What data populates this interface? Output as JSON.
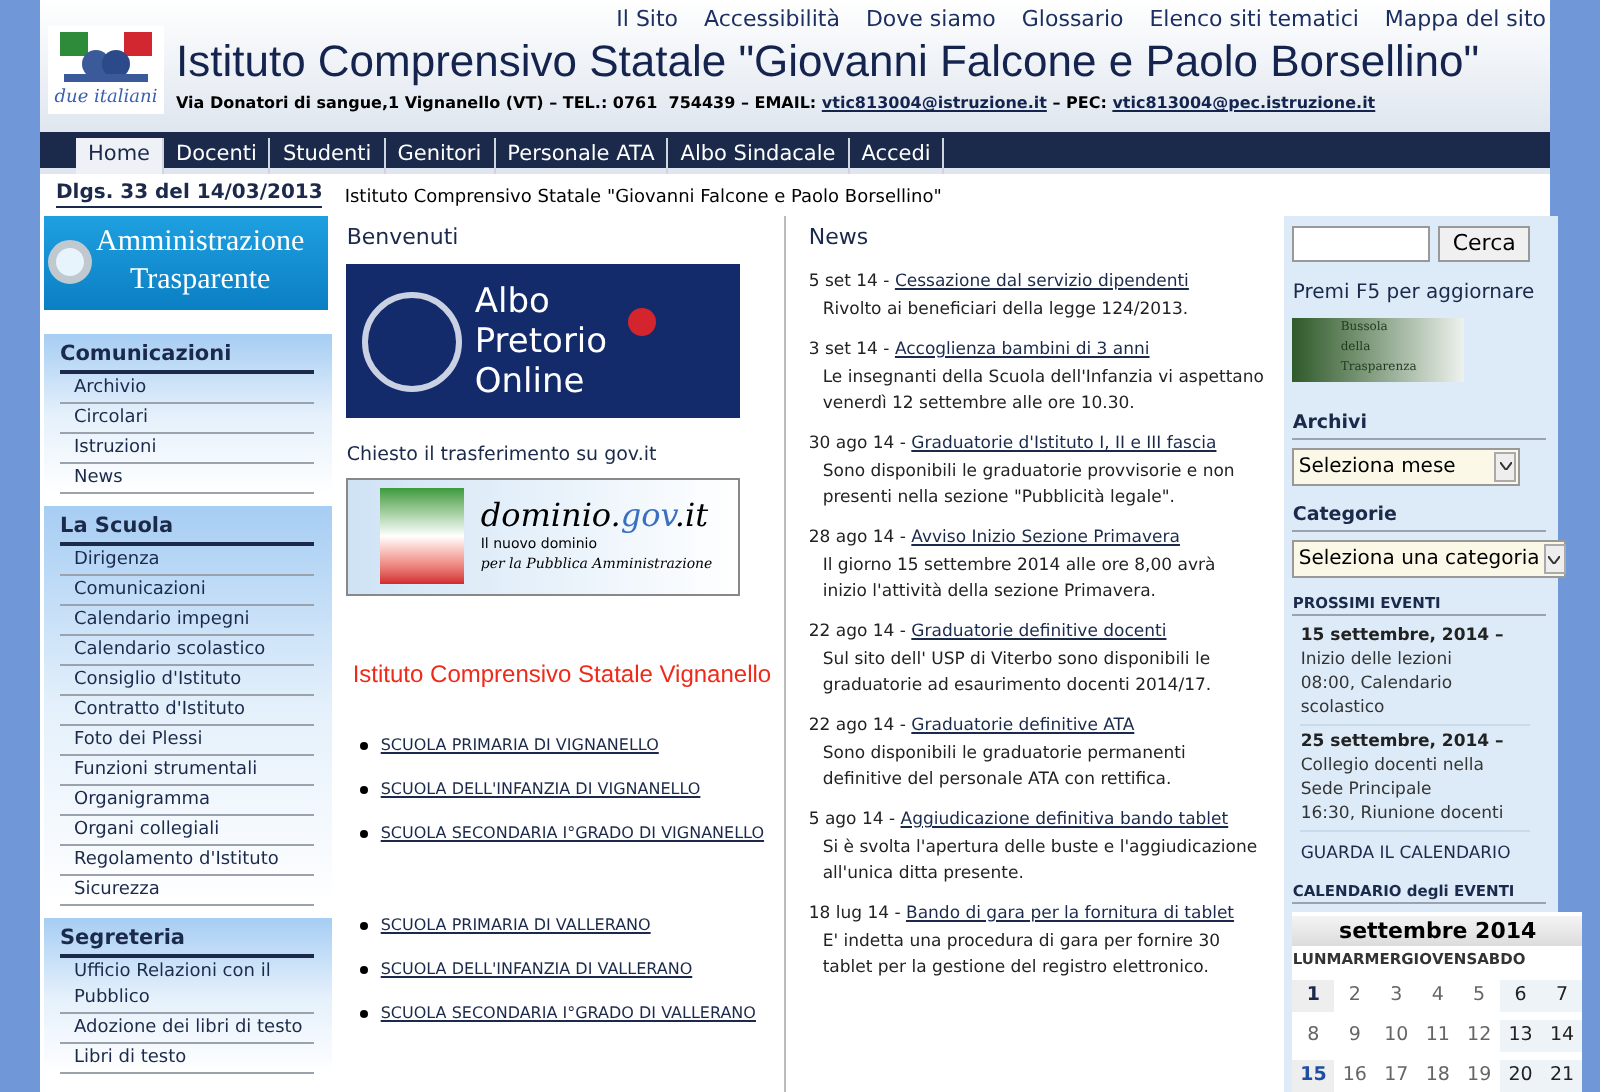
{
  "top_links": [
    "Il Sito",
    "Accessibilità",
    "Dove siamo",
    "Glossario",
    "Elenco siti tematici",
    "Mappa del sito"
  ],
  "logo": {
    "caption": "due italiani"
  },
  "header": {
    "title": "Istituto Comprensivo Statale \"Giovanni Falcone e Paolo Borsellino\"",
    "address": "Via Donatori di sangue,1 Vignanello (VT) – TEL.: 0761  754439 – EMAIL: ",
    "email": "vtic813004@istruzione.it",
    "pec_label": " – PEC: ",
    "pec": "vtic813004@pec.istruzione.it"
  },
  "nav": [
    {
      "label": "Home",
      "selected": true
    },
    {
      "label": "Docenti",
      "selected": false
    },
    {
      "label": "Studenti",
      "selected": false
    },
    {
      "label": "Genitori",
      "selected": false
    },
    {
      "label": "Personale ATA",
      "selected": false
    },
    {
      "label": "Albo Sindacale",
      "selected": false
    },
    {
      "label": "Accedi",
      "selected": false
    }
  ],
  "sidebar": {
    "decree": "Dlgs. 33 del 14/03/2013",
    "banner": [
      "Amministrazione",
      "Trasparente"
    ],
    "sections": [
      {
        "title": "Comunicazioni",
        "items": [
          "Archivio",
          "Circolari",
          "Istruzioni",
          "News"
        ]
      },
      {
        "title": "La Scuola",
        "items": [
          "Dirigenza",
          "Comunicazioni",
          "Calendario impegni",
          "Calendario scolastico",
          "Consiglio d'Istituto",
          "Contratto d'Istituto",
          "Foto dei Plessi",
          "Funzioni strumentali",
          "Organigramma",
          "Organi collegiali",
          "Regolamento d'Istituto",
          "Sicurezza"
        ]
      },
      {
        "title": "Segreteria",
        "items": [
          "Ufficio Relazioni con il Pubblico",
          "Adozione dei libri di testo",
          "Libri di testo"
        ]
      }
    ]
  },
  "breadcrumb": "Istituto Comprensivo Statale \"Giovanni Falcone e Paolo Borsellino\"",
  "welcome": {
    "title": "Benvenuti",
    "albo": [
      "Albo",
      "Pretorio",
      "Online"
    ],
    "transfer": "Chiesto il trasferimento su gov.it",
    "domain": {
      "name": "dominio.",
      "gov": "gov",
      "tld": ".it",
      "line1": "Il nuovo dominio",
      "line2": "per la Pubblica Amministrazione"
    },
    "school_title": "Istituto Comprensivo Statale Vignanello",
    "schools": [
      [
        "SCUOLA PRIMARIA DI VIGNANELLO",
        "SCUOLA DELL'INFANZIA DI VIGNANELLO",
        "SCUOLA SECONDARIA I°GRADO DI VIGNANELLO"
      ],
      [
        "SCUOLA PRIMARIA DI VALLERANO",
        "SCUOLA DELL'INFANZIA DI VALLERANO",
        "SCUOLA SECONDARIA I°GRADO DI VALLERANO"
      ]
    ]
  },
  "news": {
    "title": "News",
    "items": [
      {
        "date": "5 set 14 - ",
        "title": "Cessazione dal servizio dipendenti",
        "text": "Rivolto ai beneficiari della legge 124/2013."
      },
      {
        "date": "3 set 14 - ",
        "title": "Accoglienza bambini di 3 anni",
        "text": "Le insegnanti della Scuola dell'Infanzia vi aspettano venerdì 12 settembre alle ore 10.30."
      },
      {
        "date": "30 ago 14 - ",
        "title": "Graduatorie d'Istituto I, II e III fascia",
        "text": "Sono disponibili le graduatorie  provvisorie e non presenti nella sezione \"Pubblicità legale\"."
      },
      {
        "date": "28 ago 14 - ",
        "title": "Avviso Inizio Sezione Primavera",
        "text": "Il giorno 15 settembre 2014 alle ore 8,00 avrà inizio l'attività della sezione Primavera."
      },
      {
        "date": "22 ago 14 - ",
        "title": "Graduatorie definitive docenti",
        "text": "Sul sito dell' USP di Viterbo sono disponibili le graduatorie ad esaurimento docenti 2014/17."
      },
      {
        "date": "22 ago 14 - ",
        "title": "Graduatorie definitive ATA",
        "text": "Sono disponibili le graduatorie permanenti definitive del personale ATA con rettifica."
      },
      {
        "date": "5 ago 14 - ",
        "title": "Aggiudicazione definitiva bando tablet",
        "text": "Si è svolta l'apertura delle buste e l'aggiudicazione all'unica ditta presente."
      },
      {
        "date": "18 lug 14 - ",
        "title": "Bando di gara per la fornitura di tablet",
        "text": "E' indetta una procedura di gara per fornire 30 tablet per la gestione del registro elettronico."
      }
    ]
  },
  "right": {
    "search_button": "Cerca",
    "refresh": "Premi F5 per aggiornare",
    "bussola": [
      "Bussola",
      "della",
      "Trasparenza"
    ],
    "archives": {
      "title": "Archivi",
      "value": "Seleziona mese"
    },
    "categories": {
      "title": "Categorie",
      "value": "Seleziona una categoria"
    },
    "events_title": "PROSSIMI EVENTI",
    "events": [
      {
        "date": "15 settembre, 2014 –",
        "lines": [
          "Inizio delle lezioni",
          "08:00, Calendario scolastico"
        ]
      },
      {
        "date": "25 settembre, 2014 –",
        "lines": [
          "Collegio docenti nella Sede Principale",
          "16:30, Riunione docenti"
        ]
      }
    ],
    "calendar_link": "GUARDA IL CALENDARIO",
    "calendar_title": "CALENDARIO degli EVENTI",
    "calendar": {
      "month": "settembre 2014",
      "weekdays": [
        "LUN",
        "MAR",
        "MER",
        "GIO",
        "VEN",
        "SAB",
        "DO"
      ],
      "weeks": [
        [
          {
            "day": "1",
            "kind": "event"
          },
          {
            "day": "2",
            "kind": "normal"
          },
          {
            "day": "3",
            "kind": "normal"
          },
          {
            "day": "4",
            "kind": "normal"
          },
          {
            "day": "5",
            "kind": "normal"
          },
          {
            "day": "6",
            "kind": "weekend"
          },
          {
            "day": "7",
            "kind": "weekend"
          }
        ],
        [
          {
            "day": "8",
            "kind": "normal"
          },
          {
            "day": "9",
            "kind": "normal"
          },
          {
            "day": "10",
            "kind": "normal"
          },
          {
            "day": "11",
            "kind": "normal"
          },
          {
            "day": "12",
            "kind": "normal"
          },
          {
            "day": "13",
            "kind": "weekend"
          },
          {
            "day": "14",
            "kind": "weekend"
          }
        ],
        [
          {
            "day": "15",
            "kind": "today"
          },
          {
            "day": "16",
            "kind": "normal"
          },
          {
            "day": "17",
            "kind": "normal"
          },
          {
            "day": "18",
            "kind": "normal"
          },
          {
            "day": "19",
            "kind": "normal"
          },
          {
            "day": "20",
            "kind": "weekend"
          },
          {
            "day": "21",
            "kind": "weekend"
          }
        ]
      ]
    }
  }
}
